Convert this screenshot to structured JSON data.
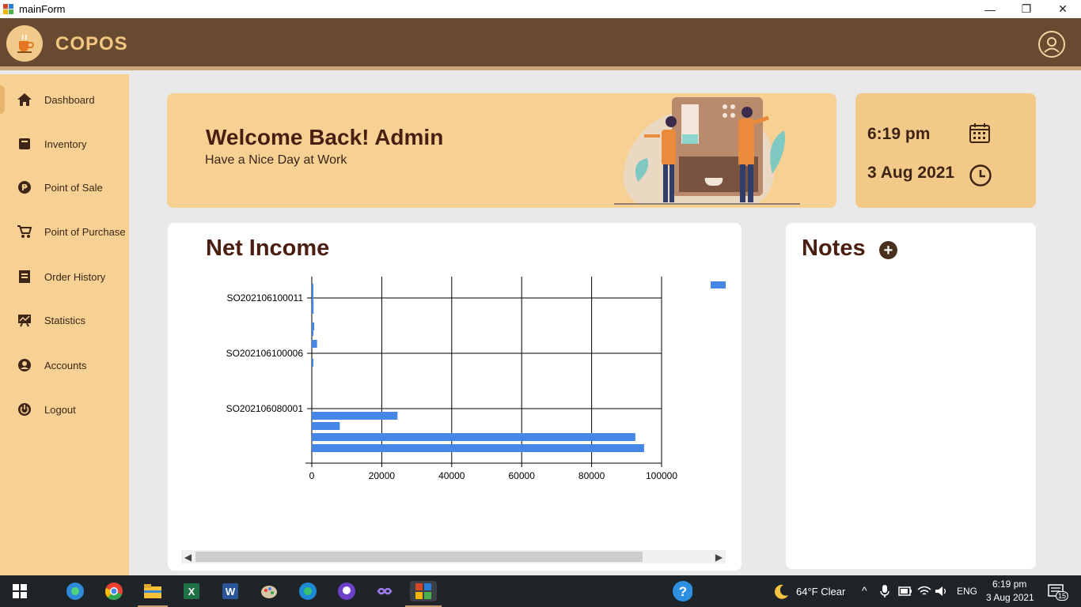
{
  "window": {
    "title": "mainForm",
    "minimize": "—",
    "restore": "❐",
    "close": "✕"
  },
  "header": {
    "brand": "COPOS"
  },
  "sidebar": {
    "items": [
      {
        "label": "Dashboard",
        "icon": "home-icon"
      },
      {
        "label": "Inventory",
        "icon": "box-icon"
      },
      {
        "label": "Point of Sale",
        "icon": "peso-icon"
      },
      {
        "label": "Point of Purchase",
        "icon": "cart-icon"
      },
      {
        "label": "Order History",
        "icon": "receipt-icon"
      },
      {
        "label": "Statistics",
        "icon": "chart-board-icon"
      },
      {
        "label": "Accounts",
        "icon": "user-circle-icon"
      },
      {
        "label": "Logout",
        "icon": "power-icon"
      }
    ]
  },
  "welcome": {
    "title": "Welcome Back! Admin",
    "subtitle": "Have a Nice Day at Work"
  },
  "clock": {
    "time": "6:19 pm",
    "date": "3 Aug 2021"
  },
  "income": {
    "title": "Net Income"
  },
  "chart_data": {
    "type": "bar",
    "orientation": "horizontal",
    "title": "Net Income",
    "categories_labeled": [
      "SO202106100011",
      "SO202106100006",
      "SO202106080001"
    ],
    "values_top_to_bottom": [
      300,
      400,
      300,
      500,
      500,
      700,
      400,
      1500,
      400,
      24500,
      8000,
      92500,
      95000
    ],
    "xlim": [
      0,
      100000
    ],
    "xticks": [
      "0",
      "20000",
      "40000",
      "60000",
      "80000",
      "100000"
    ],
    "grid": true,
    "legend": "top-right",
    "bar_color": "#4487e6"
  },
  "notes": {
    "title": "Notes",
    "add_label": "+"
  },
  "taskbar": {
    "weather": "64°F  Clear",
    "lang": "ENG",
    "time": "6:19 pm",
    "date": "3 Aug 2021",
    "notifications": "15"
  }
}
